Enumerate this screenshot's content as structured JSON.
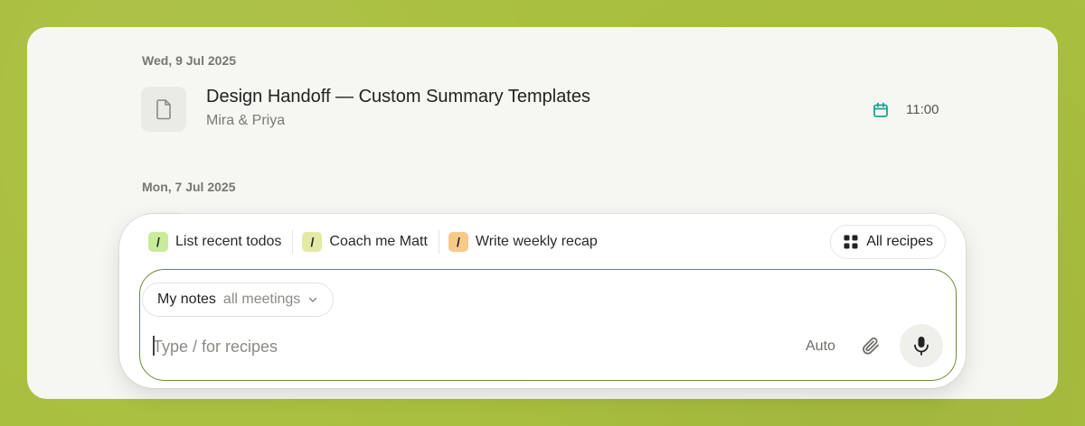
{
  "dates": [
    "Wed, 9 Jul 2025",
    "Mon, 7 Jul 2025"
  ],
  "meeting": {
    "title": "Design Handoff — Custom Summary Templates",
    "attendees": "Mira & Priya",
    "time": "11:00",
    "icon": "document-icon",
    "time_icon": "calendar-icon"
  },
  "recipes": [
    {
      "label": "List recent todos",
      "color": "#c8ec9a"
    },
    {
      "label": "Coach me Matt",
      "color": "#e3eaa6"
    },
    {
      "label": "Write weekly recap",
      "color": "#f7c98a"
    }
  ],
  "all_recipes_label": "All recipes",
  "context": {
    "main": "My notes",
    "scope": "all meetings"
  },
  "input": {
    "placeholder": "Type / for recipes",
    "value": ""
  },
  "model_label": "Auto",
  "colors": {
    "accent_border": "#6a8a3a",
    "calendar": "#16a394",
    "background": "#a9bf3f"
  }
}
